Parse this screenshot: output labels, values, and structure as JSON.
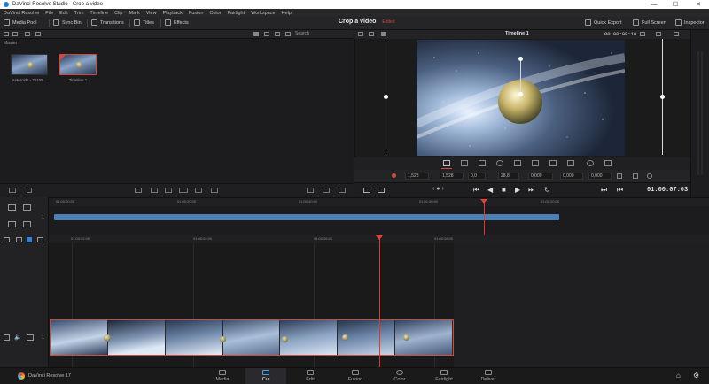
{
  "window": {
    "title": "DaVinci Resolve Studio - Crop a video",
    "min": "—",
    "max": "☐",
    "close": "✕"
  },
  "menu": [
    "DaVinci Resolve",
    "File",
    "Edit",
    "Trim",
    "Timeline",
    "Clip",
    "Mark",
    "View",
    "Playback",
    "Fusion",
    "Color",
    "Fairlight",
    "Workspace",
    "Help"
  ],
  "toolbar": {
    "media_pool": "Media Pool",
    "sync_bin": "Sync Bin",
    "transitions": "Transitions",
    "titles": "Titles",
    "effects": "Effects",
    "project_name": "Crop a video",
    "project_status": "Edited",
    "quick_export": "Quick Export",
    "full_screen": "Full Screen",
    "inspector": "Inspector"
  },
  "media_pool": {
    "search_label": "Search",
    "bin": "Master",
    "clips": [
      {
        "label": "Asteroids - 21105..."
      },
      {
        "label": "Timeline 1"
      }
    ]
  },
  "viewer": {
    "timeline_name": "Timeline 1",
    "timecode": "00:00:08:10",
    "transform_fields": {
      "width": "1,528",
      "height": "1,528",
      "pos_x": "0,0",
      "pos_y": "28,8",
      "rotation": "0,000",
      "zoom_x": "0,000",
      "zoom_y": "0,000"
    },
    "transport_timecode": "01:00:07:03"
  },
  "upper_timeline": {
    "ticks": [
      "01:00:00:00",
      "01:00:20:00",
      "01:00:40:00",
      "01:01:00:00",
      "01:01:20:00"
    ],
    "track": "1"
  },
  "lower_timeline": {
    "ticks": [
      "01:00:02:00",
      "01:00:04:00",
      "01:00:06:00",
      "01:00:08:00"
    ],
    "track": "1"
  },
  "bottom": {
    "app_name": "DaVinci Resolve 17",
    "pages": [
      "Media",
      "Cut",
      "Edit",
      "Fusion",
      "Color",
      "Fairlight",
      "Deliver"
    ],
    "active_page": "Cut"
  },
  "colors": {
    "accent": "#d04a3e",
    "clip_blue": "#4d7fb3",
    "playhead": "#d83a2e"
  }
}
